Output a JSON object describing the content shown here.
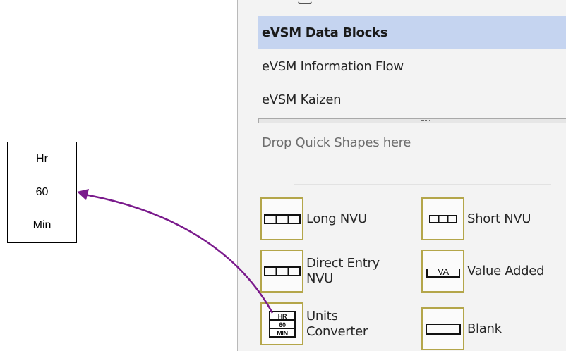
{
  "converter": {
    "top": "Hr",
    "middle": "60",
    "bottom": "Min"
  },
  "stencils": {
    "items": [
      {
        "label": "eVSM Data Blocks"
      },
      {
        "label": "eVSM Information Flow"
      },
      {
        "label": "eVSM Kaizen"
      }
    ],
    "drop_hint": "Drop Quick Shapes here"
  },
  "shapes": [
    {
      "label_line1": "Long NVU",
      "label_line2": "",
      "icon": "long-nvu-icon"
    },
    {
      "label_line1": "Short NVU",
      "label_line2": "",
      "icon": "short-nvu-icon"
    },
    {
      "label_line1": "Direct Entry",
      "label_line2": "NVU",
      "icon": "direct-entry-nvu-icon"
    },
    {
      "label_line1": "Value Added",
      "label_line2": "",
      "icon": "value-added-icon",
      "icon_text": "VA"
    },
    {
      "label_line1": "Units",
      "label_line2": "Converter",
      "icon": "units-converter-icon",
      "icon_lines": [
        "HR",
        "60",
        "MIN"
      ]
    },
    {
      "label_line1": "Blank",
      "label_line2": "",
      "icon": "blank-icon"
    }
  ],
  "colors": {
    "selected_bg": "#c5d4f0",
    "icon_border": "#b4a64a",
    "arrow": "#7a1a8c"
  }
}
